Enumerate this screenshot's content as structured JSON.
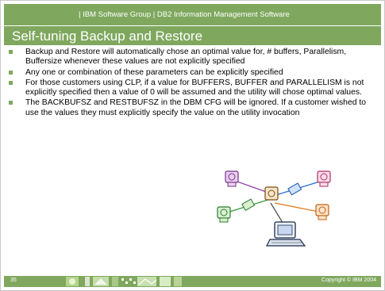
{
  "header": {
    "text": "| IBM Software Group  |  DB2 Information Management Software"
  },
  "title": "Self-tuning Backup and Restore",
  "bullets": [
    "Backup and Restore will automatically chose an optimal value for, # buffers, Parallelism, Buffersize whenever these values are not explicitly specified",
    "Any one or combination of these parameters can be explicitly specified",
    "For those customers using CLP, if a value for BUFFERS, BUFFER and PARALLELISM is not explicitly specified then a value of 0 will be assumed and the utility will chose optimal values.",
    "The BACKBUFSZ and RESTBUFSZ in the DBM CFG will be ignored.  If a customer wished to use the values they must explicitly specify the value on the utility invocation"
  ],
  "footer": {
    "page_number": "35",
    "copyright": "Copyright © IBM 2004"
  },
  "colors": {
    "accent": "#7fa85e",
    "text": "#000000"
  },
  "clipart": {
    "icons": [
      "network-computers-clipart"
    ]
  }
}
